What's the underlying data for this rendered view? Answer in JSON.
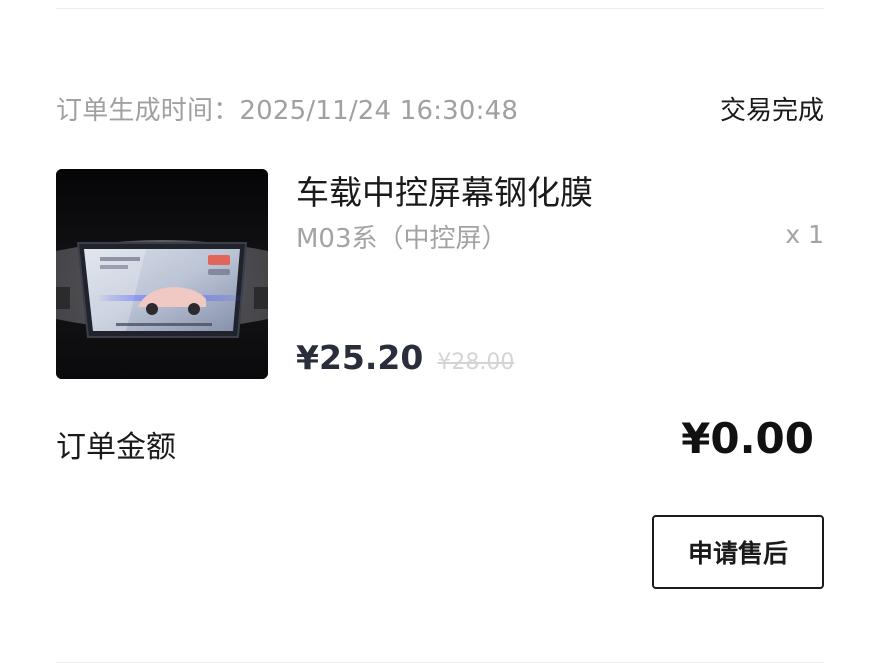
{
  "order": {
    "time_label": "订单生成时间：",
    "time_value": "2025/11/24 16:30:48",
    "status": "交易完成"
  },
  "product": {
    "image_icon": "car-screen-protector-image",
    "name": "车载中控屏幕钢化膜",
    "spec": "M03系（中控屏）",
    "quantity": "x 1",
    "price": "¥25.20",
    "original_price": "¥28.00"
  },
  "summary": {
    "amount_label": "订单金额",
    "amount_value": "¥0.00"
  },
  "actions": {
    "after_sale_label": "申请售后"
  }
}
